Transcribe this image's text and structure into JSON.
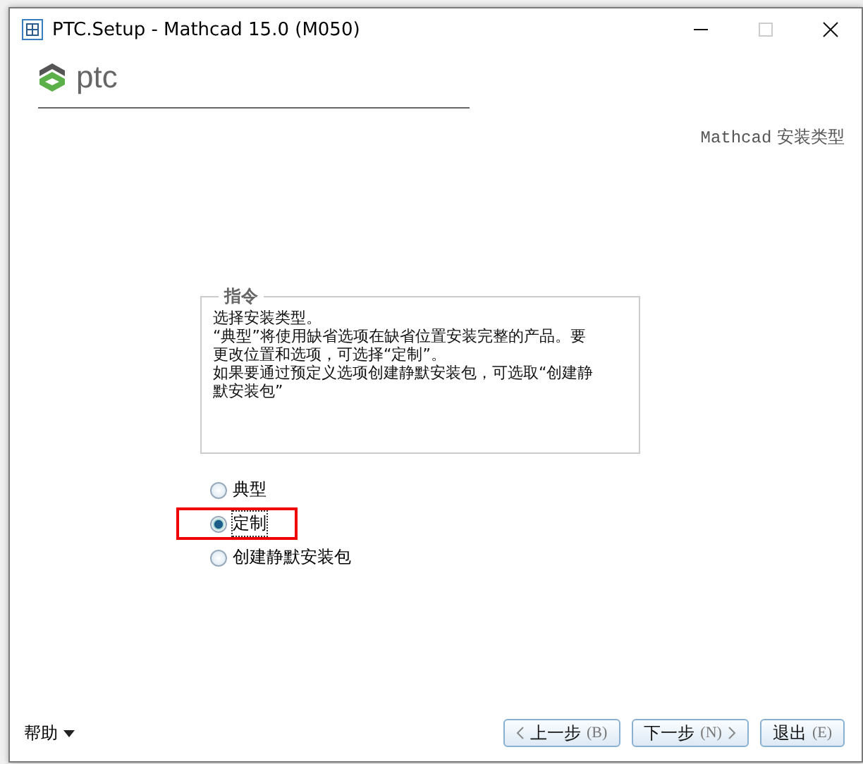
{
  "window": {
    "title": "PTC.Setup - Mathcad 15.0 (M050)"
  },
  "logo": {
    "text": "ptc"
  },
  "step_title": {
    "product": "Mathcad",
    "text": "安装类型"
  },
  "instructions": {
    "legend": "指令",
    "paragraphs": [
      "选择安装类型。",
      "“典型”将使用缺省选项在缺省位置安装完整的产品。要更改位置和选项，可选择“定制”。",
      "如果要通过预定义选项创建静默安装包，可选取“创建静默安装包”"
    ]
  },
  "options": [
    {
      "label": "典型",
      "selected": false
    },
    {
      "label": "定制",
      "selected": true
    },
    {
      "label": "创建静默安装包",
      "selected": false
    }
  ],
  "help": {
    "label": "帮助"
  },
  "buttons": [
    {
      "kind": "back",
      "label": "上一步",
      "mnemonic": "(B)"
    },
    {
      "kind": "next",
      "label": "下一步",
      "mnemonic": "(N)"
    },
    {
      "kind": "exit",
      "label": "退出",
      "mnemonic": "(E)"
    }
  ]
}
